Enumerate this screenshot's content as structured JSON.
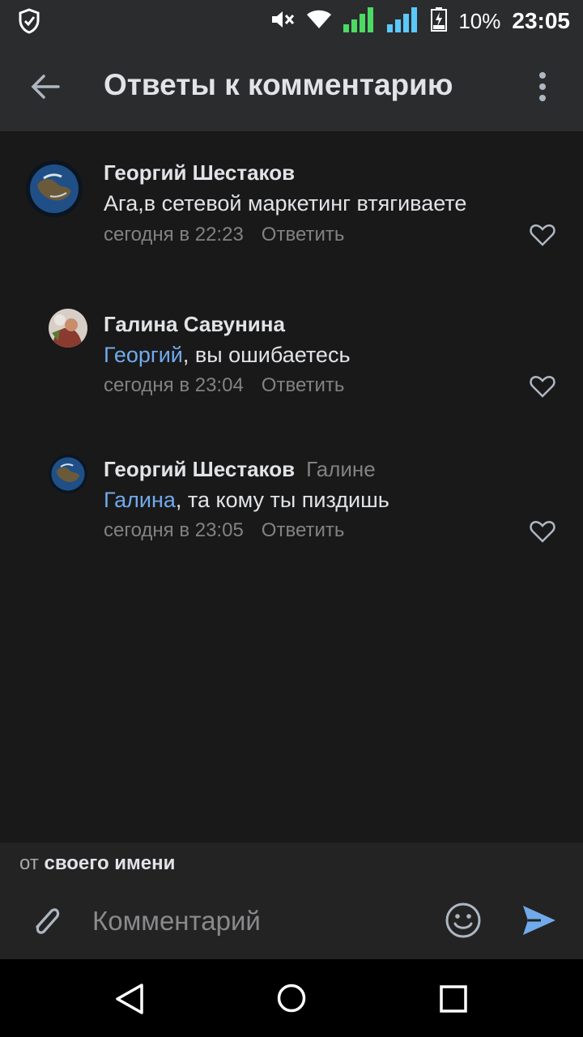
{
  "status_bar": {
    "battery_percent": "10%",
    "time": "23:05",
    "icons": [
      "shield-icon",
      "mute-icon",
      "wifi-icon",
      "signal-icon",
      "signal-icon",
      "battery-icon"
    ]
  },
  "app_bar": {
    "title": "Ответы к комментарию",
    "back_icon": "arrow-back-icon",
    "menu_icon": "more-vert-icon"
  },
  "comments": [
    {
      "author": "Георгий Шестаков",
      "recipient": "",
      "mention": "",
      "text": "Ага,в сетевой маркетинг втягиваете",
      "time": "сегодня в 22:23",
      "reply_label": "Ответить",
      "avatar": "earth-avatar"
    },
    {
      "author": "Галина Савунина",
      "recipient": "",
      "mention": "Георгий",
      "text": ", вы ошибаетесь",
      "time": "сегодня в 23:04",
      "reply_label": "Ответить",
      "avatar": "photo-avatar"
    },
    {
      "author": "Георгий Шестаков",
      "recipient": "Галине",
      "mention": "Галина",
      "text": ", та кому ты пиздишь",
      "time": "сегодня в 23:05",
      "reply_label": "Ответить",
      "avatar": "earth-avatar"
    }
  ],
  "composer": {
    "from_prefix": "от",
    "from_value": "своего имени",
    "placeholder": "Комментарий"
  },
  "colors": {
    "background": "#19191a",
    "bar": "#2b2c2e",
    "accent": "#71aaeb",
    "secondary_text": "#828282"
  }
}
